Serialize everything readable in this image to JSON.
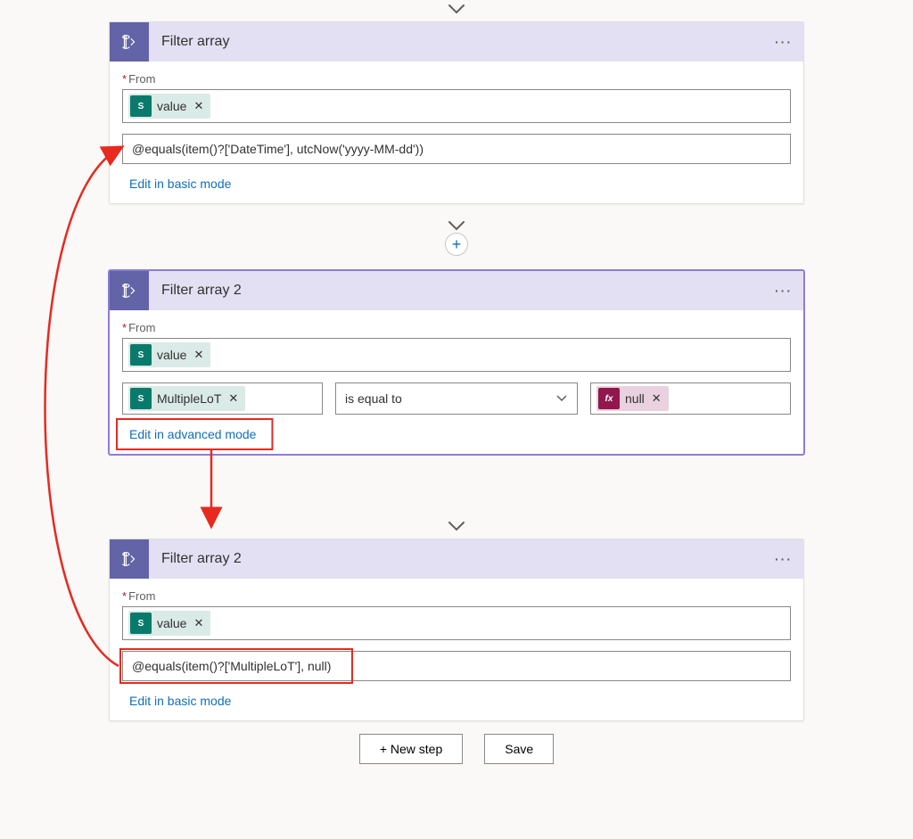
{
  "labels": {
    "from": "From",
    "value_token": "value",
    "mult_token": "MultipleLoT",
    "null_token": "null",
    "fx": "fx",
    "operator": "is equal to",
    "basic_mode": "Edit in basic mode",
    "adv_mode": "Edit in advanced mode",
    "new_step": "+ New step",
    "save": "Save"
  },
  "cards": {
    "c1": {
      "title": "Filter array",
      "expression": "@equals(item()?['DateTime'], utcNow('yyyy-MM-dd'))"
    },
    "c2": {
      "title": "Filter array 2"
    },
    "c3": {
      "title": "Filter array 2",
      "expression": "@equals(item()?['MultipleLoT'], null)"
    }
  }
}
